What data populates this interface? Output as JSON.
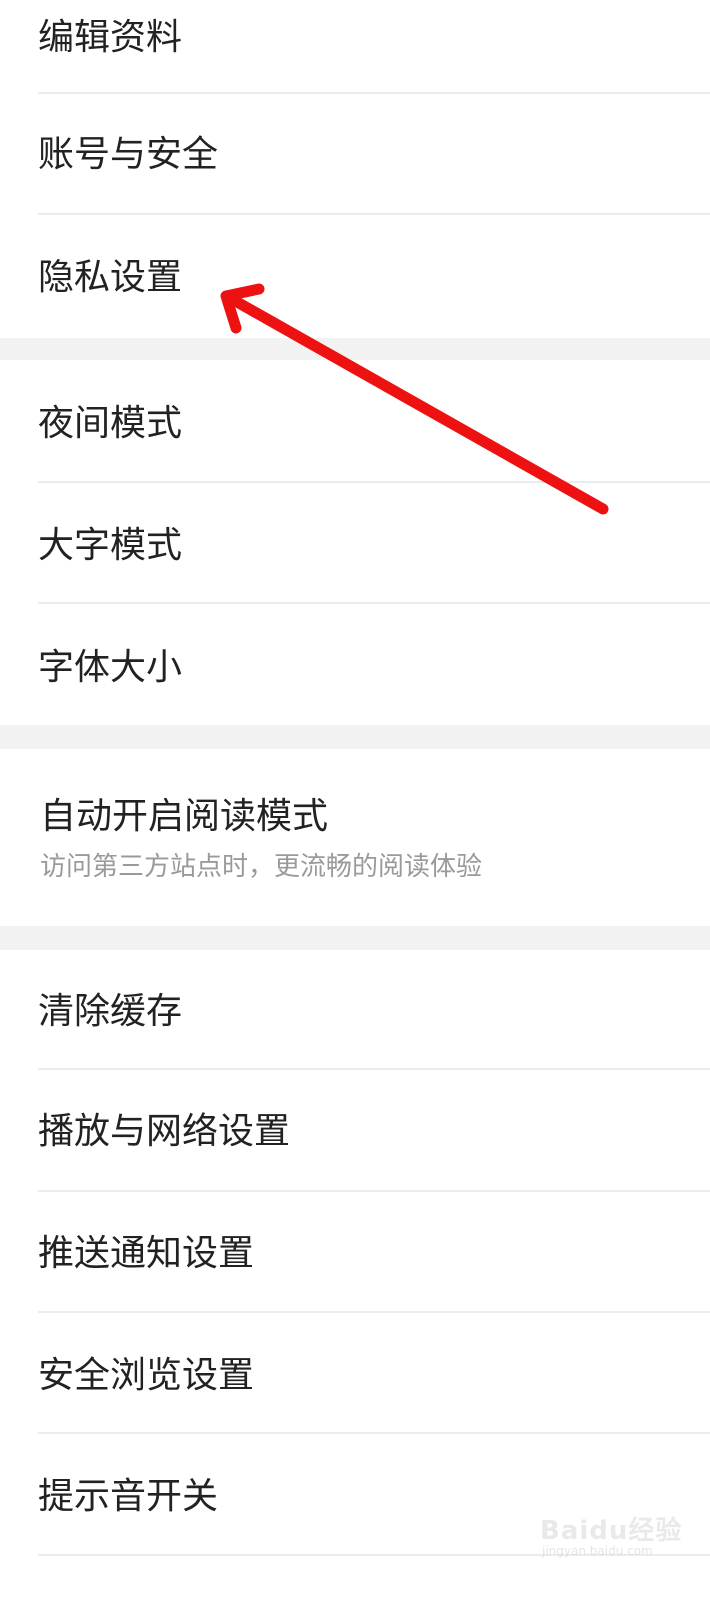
{
  "settings": {
    "group1": [
      {
        "label": "编辑资料"
      },
      {
        "label": "账号与安全"
      },
      {
        "label": "隐私设置"
      }
    ],
    "group2": [
      {
        "label": "夜间模式"
      },
      {
        "label": "大字模式"
      },
      {
        "label": "字体大小"
      }
    ],
    "group3": [
      {
        "label": "自动开启阅读模式",
        "sub": "访问第三方站点时，更流畅的阅读体验"
      }
    ],
    "group4": [
      {
        "label": "清除缓存"
      },
      {
        "label": "播放与网络设置"
      },
      {
        "label": "推送通知设置"
      },
      {
        "label": "安全浏览设置"
      },
      {
        "label": "提示音开关"
      }
    ]
  },
  "annotation": {
    "color": "#ee1111",
    "icon": "arrow-pointing-left"
  },
  "watermark": {
    "brand": "Baidu经验",
    "url": "jingyan.baidu.com"
  }
}
